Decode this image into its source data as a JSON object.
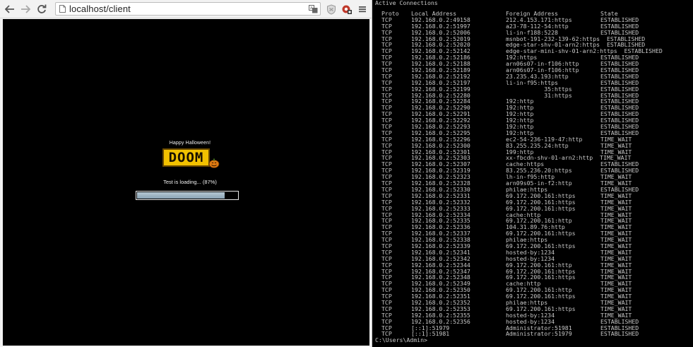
{
  "browser": {
    "url": "localhost/client",
    "game": {
      "banner": "Happy Halloween!",
      "logo_text": "DOOM",
      "loading_text": "Test is loading... (87%)",
      "progress": 0.87
    }
  },
  "console": {
    "title": "Active Connections",
    "headers": {
      "proto": "Proto",
      "local": "Local Address",
      "foreign": "Foreign Address",
      "state": "State"
    },
    "rows": [
      {
        "proto": "TCP",
        "local": "192.168.0.2:49158",
        "foreign": "212.4.153.171:https",
        "state": "ESTABLISHED"
      },
      {
        "proto": "TCP",
        "local": "192.168.0.2:51997",
        "foreign": "a23-78-112-54:http",
        "state": "ESTABLISHED"
      },
      {
        "proto": "TCP",
        "local": "192.168.0.2:52006",
        "foreign": "li-in-f188:5228",
        "state": "ESTABLISHED"
      },
      {
        "proto": "TCP",
        "local": "192.168.0.2:52019",
        "foreign": "msnbot-191-232-139-62:https  ESTABLISHED",
        "state": ""
      },
      {
        "proto": "TCP",
        "local": "192.168.0.2:52020",
        "foreign": "edge-star-shv-01-arn2:https  ESTABLISHED",
        "state": ""
      },
      {
        "proto": "TCP",
        "local": "192.168.0.2:52142",
        "foreign": "edge-star-mini-shv-01-arn2:https  ESTABLISHED",
        "state": ""
      },
      {
        "proto": "TCP",
        "local": "192.168.0.2:52186",
        "foreign": "192:https",
        "state": "ESTABLISHED"
      },
      {
        "proto": "TCP",
        "local": "192.168.0.2:52188",
        "foreign": "arn06s07-in-f106:http",
        "state": "ESTABLISHED"
      },
      {
        "proto": "TCP",
        "local": "192.168.0.2:52189",
        "foreign": "arn06s07-in-f106:http",
        "state": "ESTABLISHED"
      },
      {
        "proto": "TCP",
        "local": "192.168.0.2:52192",
        "foreign": "23.235.43.193:http",
        "state": "ESTABLISHED"
      },
      {
        "proto": "TCP",
        "local": "192.168.0.2:52197",
        "foreign": "li-in-f95:https",
        "state": "ESTABLISHED"
      },
      {
        "proto": "TCP",
        "local": "192.168.0.2:52199",
        "foreign": "           35:https",
        "state": "ESTABLISHED"
      },
      {
        "proto": "TCP",
        "local": "192.168.0.2:52280",
        "foreign": "           31:https",
        "state": "ESTABLISHED"
      },
      {
        "proto": "TCP",
        "local": "192.168.0.2:52284",
        "foreign": "192:http",
        "state": "ESTABLISHED"
      },
      {
        "proto": "TCP",
        "local": "192.168.0.2:52290",
        "foreign": "192:http",
        "state": "ESTABLISHED"
      },
      {
        "proto": "TCP",
        "local": "192.168.0.2:52291",
        "foreign": "192:http",
        "state": "ESTABLISHED"
      },
      {
        "proto": "TCP",
        "local": "192.168.0.2:52292",
        "foreign": "192:http",
        "state": "ESTABLISHED"
      },
      {
        "proto": "TCP",
        "local": "192.168.0.2:52293",
        "foreign": "192:http",
        "state": "ESTABLISHED"
      },
      {
        "proto": "TCP",
        "local": "192.168.0.2:52295",
        "foreign": "192:http",
        "state": "ESTABLISHED"
      },
      {
        "proto": "TCP",
        "local": "192.168.0.2:52296",
        "foreign": "ec2-54-236-119-47:http",
        "state": "TIME_WAIT"
      },
      {
        "proto": "TCP",
        "local": "192.168.0.2:52300",
        "foreign": "83.255.235.24:http",
        "state": "TIME_WAIT"
      },
      {
        "proto": "TCP",
        "local": "192.168.0.2:52301",
        "foreign": "199:http",
        "state": "TIME_WAIT"
      },
      {
        "proto": "TCP",
        "local": "192.168.0.2:52303",
        "foreign": "xx-fbcdn-shv-01-arn2:http  TIME_WAIT",
        "state": ""
      },
      {
        "proto": "TCP",
        "local": "192.168.0.2:52307",
        "foreign": "cache:https",
        "state": "ESTABLISHED"
      },
      {
        "proto": "TCP",
        "local": "192.168.0.2:52319",
        "foreign": "83.255.236.20:https",
        "state": "ESTABLISHED"
      },
      {
        "proto": "TCP",
        "local": "192.168.0.2:52323",
        "foreign": "lh-in-f95:http",
        "state": "TIME_WAIT"
      },
      {
        "proto": "TCP",
        "local": "192.168.0.2:52328",
        "foreign": "arn09s05-in-f2:http",
        "state": "TIME_WAIT"
      },
      {
        "proto": "TCP",
        "local": "192.168.0.2:52330",
        "foreign": "philae:https",
        "state": "ESTABLISHED"
      },
      {
        "proto": "TCP",
        "local": "192.168.0.2:52331",
        "foreign": "69.172.200.161:https",
        "state": "TIME_WAIT"
      },
      {
        "proto": "TCP",
        "local": "192.168.0.2:52332",
        "foreign": "69.172.200.161:https",
        "state": "TIME_WAIT"
      },
      {
        "proto": "TCP",
        "local": "192.168.0.2:52333",
        "foreign": "69.172.200.161:https",
        "state": "TIME_WAIT"
      },
      {
        "proto": "TCP",
        "local": "192.168.0.2:52334",
        "foreign": "cache:http",
        "state": "TIME_WAIT"
      },
      {
        "proto": "TCP",
        "local": "192.168.0.2:52335",
        "foreign": "69.172.200.161:http",
        "state": "TIME_WAIT"
      },
      {
        "proto": "TCP",
        "local": "192.168.0.2:52336",
        "foreign": "104.31.89.76:http",
        "state": "TIME_WAIT"
      },
      {
        "proto": "TCP",
        "local": "192.168.0.2:52337",
        "foreign": "69.172.200.161:https",
        "state": "TIME_WAIT"
      },
      {
        "proto": "TCP",
        "local": "192.168.0.2:52338",
        "foreign": "philae:https",
        "state": "TIME_WAIT"
      },
      {
        "proto": "TCP",
        "local": "192.168.0.2:52339",
        "foreign": "69.172.200.161:https",
        "state": "TIME_WAIT"
      },
      {
        "proto": "TCP",
        "local": "192.168.0.2:52341",
        "foreign": "hosted-by:1234",
        "state": "TIME_WAIT"
      },
      {
        "proto": "TCP",
        "local": "192.168.0.2:52342",
        "foreign": "hosted-by:1234",
        "state": "TIME_WAIT"
      },
      {
        "proto": "TCP",
        "local": "192.168.0.2:52344",
        "foreign": "69.172.200.161:http",
        "state": "TIME_WAIT"
      },
      {
        "proto": "TCP",
        "local": "192.168.0.2:52347",
        "foreign": "69.172.200.161:https",
        "state": "TIME_WAIT"
      },
      {
        "proto": "TCP",
        "local": "192.168.0.2:52348",
        "foreign": "69.172.200.161:https",
        "state": "TIME_WAIT"
      },
      {
        "proto": "TCP",
        "local": "192.168.0.2:52349",
        "foreign": "cache:http",
        "state": "TIME_WAIT"
      },
      {
        "proto": "TCP",
        "local": "192.168.0.2:52350",
        "foreign": "69.172.200.161:http",
        "state": "TIME_WAIT"
      },
      {
        "proto": "TCP",
        "local": "192.168.0.2:52351",
        "foreign": "69.172.200.161:https",
        "state": "TIME_WAIT"
      },
      {
        "proto": "TCP",
        "local": "192.168.0.2:52352",
        "foreign": "philae:https",
        "state": "TIME_WAIT"
      },
      {
        "proto": "TCP",
        "local": "192.168.0.2:52353",
        "foreign": "69.172.200.161:https",
        "state": "TIME_WAIT"
      },
      {
        "proto": "TCP",
        "local": "192.168.0.2:52355",
        "foreign": "hosted-by:1234",
        "state": "TIME_WAIT"
      },
      {
        "proto": "TCP",
        "local": "192.168.0.2:52356",
        "foreign": "hosted-by:1234",
        "state": "ESTABLISHED"
      },
      {
        "proto": "TCP",
        "local": "[::1]:51979",
        "foreign": "Administrator:51981",
        "state": "ESTABLISHED"
      },
      {
        "proto": "TCP",
        "local": "[::1]:51981",
        "foreign": "Administrator:51979",
        "state": "ESTABLISHED"
      }
    ],
    "prompt": "C:\\Users\\Admin>"
  }
}
